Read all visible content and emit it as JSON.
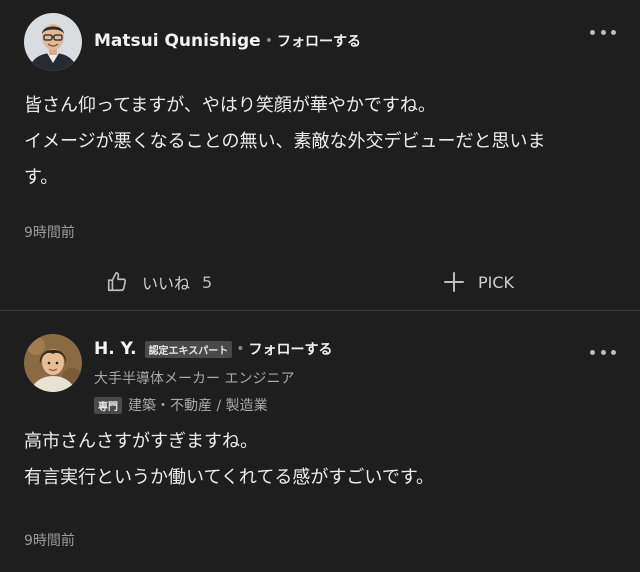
{
  "comments": [
    {
      "author": "Matsui Qunishige",
      "follow_label": "フォローする",
      "separator": "•",
      "body_lines": [
        "皆さん仰ってますが、やはり笑顔が華やかですね。",
        "イメージが悪くなることの無い、素敵な外交デビューだと思いま",
        "す。"
      ],
      "timestamp": "9時間前",
      "like_label": "いいね",
      "like_count": "5",
      "pick_label": "PICK"
    },
    {
      "author": "H. Y.",
      "expert_badge": "認定エキスパート",
      "follow_label": "フォローする",
      "separator": "•",
      "affiliation": "大手半導体メーカー エンジニア",
      "specialty_badge": "専門",
      "specialty": "建築・不動産 / 製造業",
      "body_lines": [
        "高市さんさすがすぎますね。",
        "有言実行というか働いてくれてる感がすごいです。"
      ],
      "timestamp": "9時間前"
    }
  ],
  "colors": {
    "background": "#1e1e1e",
    "text": "#ececec",
    "muted": "#9a9a9a",
    "divider": "#3a3a3a"
  },
  "icons": [
    "more-icon",
    "thumbs-up-icon",
    "plus-icon"
  ]
}
